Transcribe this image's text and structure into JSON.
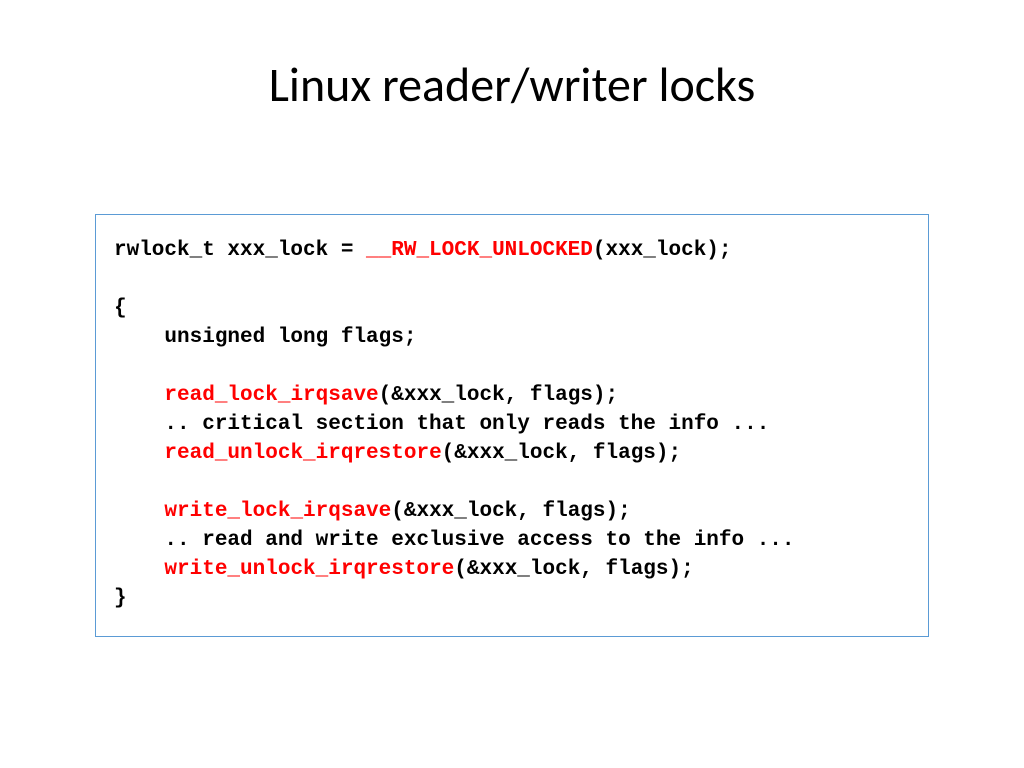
{
  "title": "Linux reader/writer locks",
  "code": {
    "line1_a": "rwlock_t xxx_lock = ",
    "line1_red": "__RW_LOCK_UNLOCKED",
    "line1_b": "(xxx_lock);",
    "line3": "{",
    "line4": "    unsigned long flags;",
    "line6_a": "    ",
    "line6_red": "read_lock_irqsave",
    "line6_b": "(&xxx_lock, flags);",
    "line7": "    .. critical section that only reads the info ...",
    "line8_a": "    ",
    "line8_red": "read_unlock_irqrestore",
    "line8_b": "(&xxx_lock, flags);",
    "line10_a": "    ",
    "line10_red": "write_lock_irqsave",
    "line10_b": "(&xxx_lock, flags);",
    "line11": "    .. read and write exclusive access to the info ...",
    "line12_a": "    ",
    "line12_red": "write_unlock_irqrestore",
    "line12_b": "(&xxx_lock, flags);",
    "line13": "}"
  }
}
